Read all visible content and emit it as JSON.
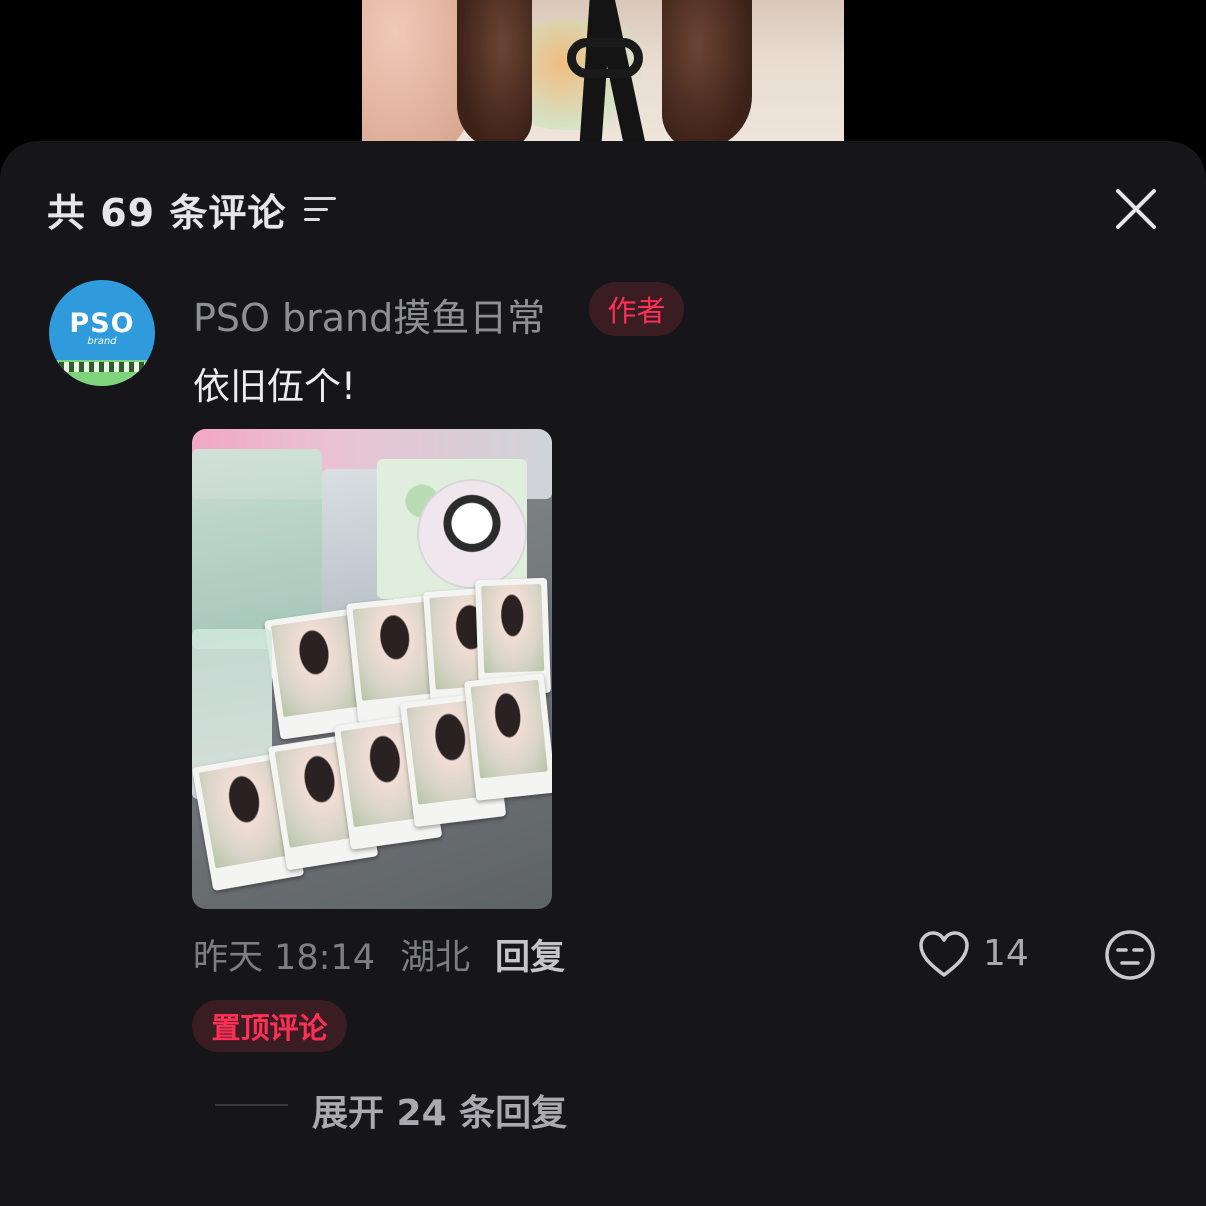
{
  "header": {
    "comment_count_label": "共 69 条评论"
  },
  "comment": {
    "username": "PSO brand摸鱼日常",
    "author_badge": "作者",
    "text": "依旧伍个!",
    "avatar": {
      "text": "PSO",
      "subtext": "brand"
    },
    "time": "昨天 18:14",
    "location": "湖北",
    "reply_label": "回复",
    "like_count": "14",
    "pinned_label": "置顶评论",
    "expand_replies_label": "展开 24 条回复"
  },
  "colors": {
    "sheet_bg": "#16161a",
    "accent_red": "#ff2f55",
    "badge_bg": "#3a1c23",
    "avatar_blue": "#2f9bdc"
  }
}
